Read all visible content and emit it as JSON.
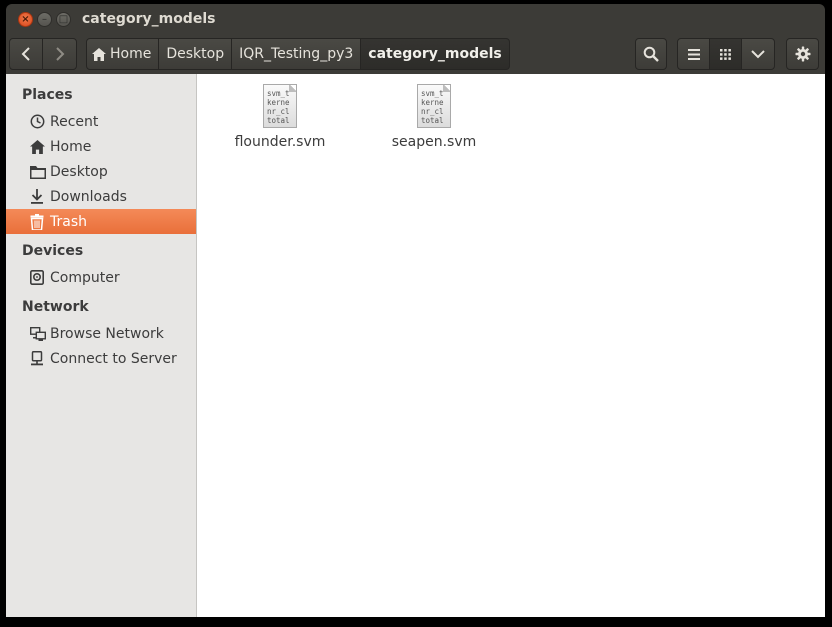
{
  "window": {
    "title": "category_models"
  },
  "breadcrumb": [
    "Home",
    "Desktop",
    "IQR_Testing_py3",
    "category_models"
  ],
  "sidebar": {
    "places_header": "Places",
    "places": [
      {
        "label": "Recent",
        "icon": "clock-icon"
      },
      {
        "label": "Home",
        "icon": "home-icon"
      },
      {
        "label": "Desktop",
        "icon": "folder-icon"
      },
      {
        "label": "Downloads",
        "icon": "download-icon"
      },
      {
        "label": "Trash",
        "icon": "trash-icon",
        "selected": true
      }
    ],
    "devices_header": "Devices",
    "devices": [
      {
        "label": "Computer",
        "icon": "drive-icon"
      }
    ],
    "network_header": "Network",
    "network": [
      {
        "label": "Browse Network",
        "icon": "network-icon"
      },
      {
        "label": "Connect to Server",
        "icon": "server-icon"
      }
    ]
  },
  "files": [
    {
      "name": "flounder.svm",
      "preview": [
        "svm_t",
        "kerne",
        "nr_cl",
        "total"
      ]
    },
    {
      "name": "seapen.svm",
      "preview": [
        "svm_t",
        "kerne",
        "nr_cl",
        "total"
      ]
    }
  ],
  "colors": {
    "accent": "#e96f3a",
    "titlebar": "#3c3b37",
    "sidebar": "#e7e6e4"
  }
}
